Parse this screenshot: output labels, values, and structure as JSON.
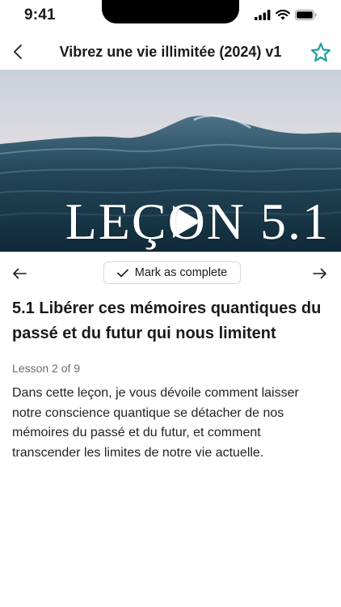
{
  "status_bar": {
    "time": "9:41"
  },
  "header": {
    "title": "Vibrez une vie illimitée (2024) v1",
    "accent_color": "#1f9e99"
  },
  "hero": {
    "caption": "LEÇON 5.1",
    "play_icon": "play-icon"
  },
  "controls": {
    "mark_complete_label": "Mark as complete",
    "prev_icon": "arrow-left-icon",
    "next_icon": "arrow-right-icon"
  },
  "lesson": {
    "title": "5.1 Libérer ces mémoires quantiques du passé et du futur qui nous limitent",
    "count_label": "Lesson 2 of 9",
    "description": "Dans cette leçon, je vous dévoile comment laisser notre conscience quantique se détacher de nos mémoires du passé et du futur, et comment transcender les limites de notre vie actuelle."
  }
}
